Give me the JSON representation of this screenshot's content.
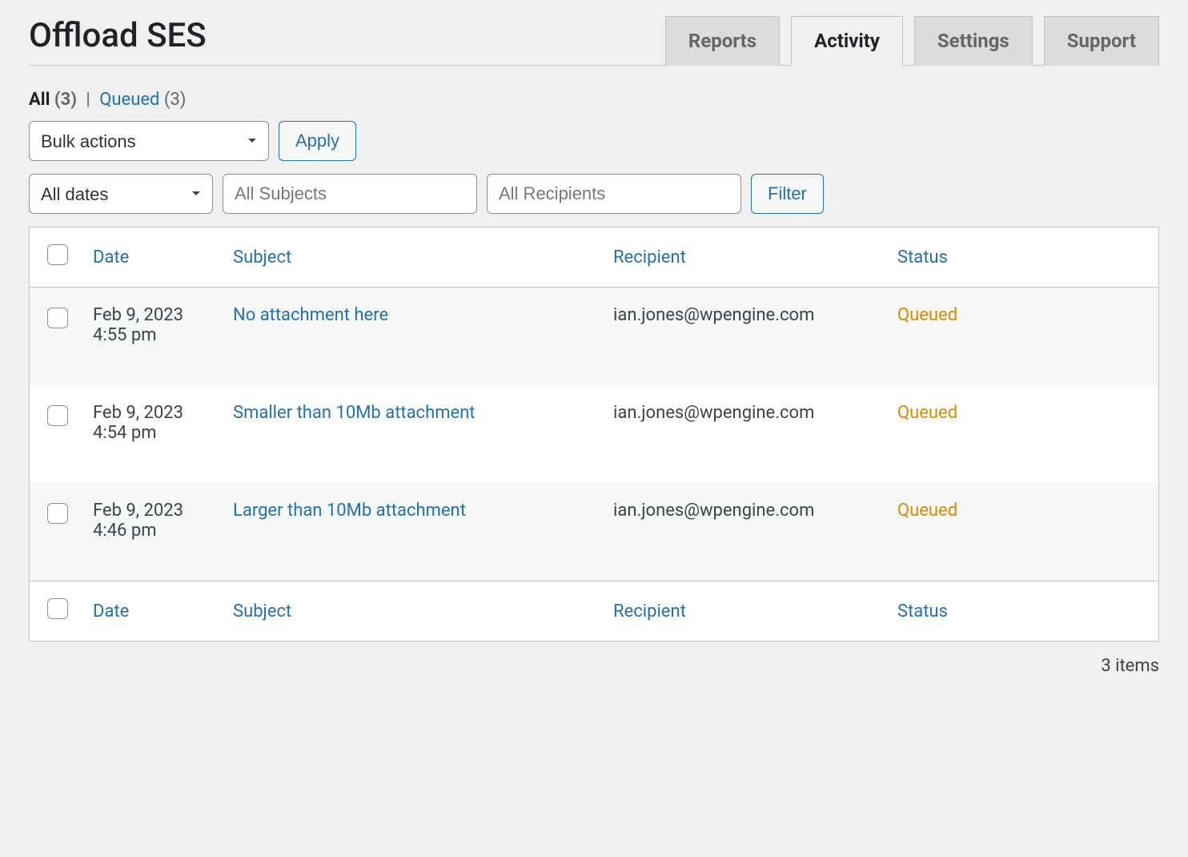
{
  "header": {
    "title": "Offload SES",
    "tabs": [
      {
        "label": "Reports",
        "active": false
      },
      {
        "label": "Activity",
        "active": true
      },
      {
        "label": "Settings",
        "active": false
      },
      {
        "label": "Support",
        "active": false
      }
    ]
  },
  "filters": {
    "views": {
      "all_label": "All",
      "all_count": "(3)",
      "queued_label": "Queued",
      "queued_count": "(3)"
    },
    "bulk_actions_label": "Bulk actions",
    "apply_label": "Apply",
    "dates_label": "All dates",
    "subjects_placeholder": "All Subjects",
    "recipients_placeholder": "All Recipients",
    "filter_label": "Filter"
  },
  "table": {
    "headers": {
      "date": "Date",
      "subject": "Subject",
      "recipient": "Recipient",
      "status": "Status"
    },
    "rows": [
      {
        "date_line1": "Feb 9, 2023",
        "date_line2": "4:55 pm",
        "subject": "No attachment here",
        "recipient": "ian.jones@wpengine.com",
        "status": "Queued"
      },
      {
        "date_line1": "Feb 9, 2023",
        "date_line2": "4:54 pm",
        "subject": "Smaller than 10Mb attachment",
        "recipient": "ian.jones@wpengine.com",
        "status": "Queued"
      },
      {
        "date_line1": "Feb 9, 2023",
        "date_line2": "4:46 pm",
        "subject": "Larger than 10Mb attachment",
        "recipient": "ian.jones@wpengine.com",
        "status": "Queued"
      }
    ]
  },
  "footer": {
    "items_count": "3 items"
  }
}
